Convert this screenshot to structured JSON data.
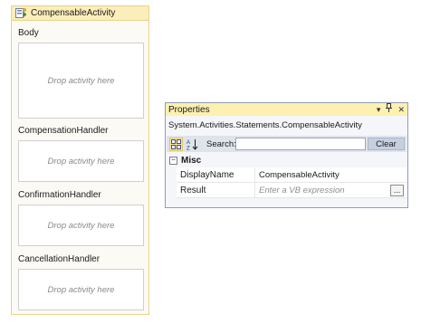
{
  "activity": {
    "title": "CompensableActivity",
    "icon": "compensable-activity-icon",
    "sections": [
      {
        "label": "Body",
        "placeholder": "Drop activity here"
      },
      {
        "label": "CompensationHandler",
        "placeholder": "Drop activity here"
      },
      {
        "label": "ConfirmationHandler",
        "placeholder": "Drop activity here"
      },
      {
        "label": "CancellationHandler",
        "placeholder": "Drop activity here"
      }
    ]
  },
  "properties": {
    "title": "Properties",
    "title_buttons": {
      "dropdown": "▾",
      "pin": "ᚠ",
      "close": "✕"
    },
    "type_name": "System.Activities.Statements.CompensableActivity",
    "toolbar": {
      "categorized_icon": "categorized-icon",
      "alphabetical_icon": "alphabetical-sort-icon",
      "search_label": "Search:",
      "search_value": "",
      "clear_label": "Clear"
    },
    "category": {
      "toggle": "−",
      "name": "Misc"
    },
    "rows": [
      {
        "name": "DisplayName",
        "value": "CompensableActivity"
      },
      {
        "name": "Result",
        "placeholder": "Enter a VB expression",
        "button": "..."
      }
    ]
  },
  "colors": {
    "activity_border": "#e7d489",
    "activity_header": "#fbeebb",
    "panel_title": "#fdf0b0",
    "panel_border": "#8e9bbc"
  }
}
